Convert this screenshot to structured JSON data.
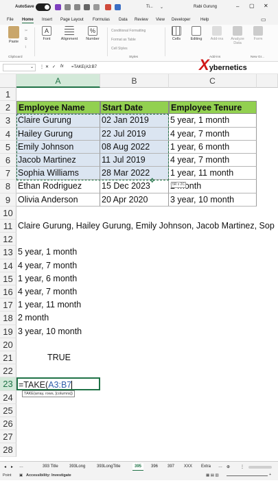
{
  "titlebar": {
    "autosave": "AutoSave",
    "file_title": "Ti...",
    "user": "Rabi Gurung"
  },
  "menu_tabs": [
    "File",
    "Home",
    "Insert",
    "Page Layout",
    "Formulas",
    "Data",
    "Review",
    "View",
    "Developer",
    "Help"
  ],
  "ribbon": {
    "paste": "Paste",
    "clipboard": "Clipboard",
    "font": "Font",
    "alignment": "Alignment",
    "number": "Number",
    "conditional": "Conditional Formatting",
    "format_table": "Format as Table",
    "cell_styles": "Cell Styles",
    "styles": "Styles",
    "cells": "Cells",
    "editing": "Editing",
    "addin": "Add-ins",
    "analyze": "Analyze Data",
    "form": "Form",
    "addins_group": "Add-ins",
    "newgroup": "New Gr..."
  },
  "formula_bar": {
    "name_box": "",
    "fx": "fx",
    "formula": "=TAKE(A3:B7"
  },
  "watermark": {
    "x": "X",
    "text": "ybernetics"
  },
  "columns": [
    "A",
    "B",
    "C"
  ],
  "rows": [
    "1",
    "2",
    "3",
    "4",
    "5",
    "6",
    "7",
    "8",
    "9",
    "10",
    "11",
    "12",
    "13",
    "14",
    "15",
    "16",
    "17",
    "18",
    "19",
    "20",
    "21",
    "22",
    "23",
    "24",
    "25",
    "26",
    "27",
    "28"
  ],
  "table": {
    "headers": [
      "Employee Name",
      "Start Date",
      "Employee Tenure"
    ],
    "rows": [
      [
        "Claire Gurung",
        "02 Jan 2019",
        "5 year, 1 month"
      ],
      [
        "Hailey Gurung",
        "22 Jul 2019",
        "4 year, 7 month"
      ],
      [
        "Emily Johnson",
        "08 Aug 2022",
        "1 year, 6 month"
      ],
      [
        "Jacob Martinez",
        "11 Jul 2019",
        "4 year, 7 month"
      ],
      [
        "Sophia Williams",
        "28 Mar 2022",
        "1 year, 11 month"
      ],
      [
        "Ethan Rodriguez",
        "15 Dec 2023",
        "2 month"
      ],
      [
        "Olivia Anderson",
        "20 Apr 2020",
        "3 year, 10 month"
      ]
    ]
  },
  "size_tooltip": "5R x 2C",
  "row11_text": "Claire Gurung, Hailey Gurung, Emily Johnson, Jacob Martinez, Sop",
  "tenure_list": [
    "5 year, 1 month",
    "4 year, 7 month",
    "1 year, 6 month",
    "4 year, 7 month",
    "1 year, 11 month",
    "2 month",
    "3 year, 10 month"
  ],
  "row21_value": "TRUE",
  "active_cell": {
    "prefix": "=TAKE(",
    "ref": "A3:B7",
    "tooltip": "TAKE(array, rows, [columns])"
  },
  "sheet_tabs": [
    "393 Title",
    "393Long",
    "393LongTitle",
    "395",
    "396",
    "397",
    "XXX",
    "Extra"
  ],
  "active_sheet": "395",
  "status": {
    "mode": "Point",
    "accessibility": "Accessibility: Investigate"
  }
}
